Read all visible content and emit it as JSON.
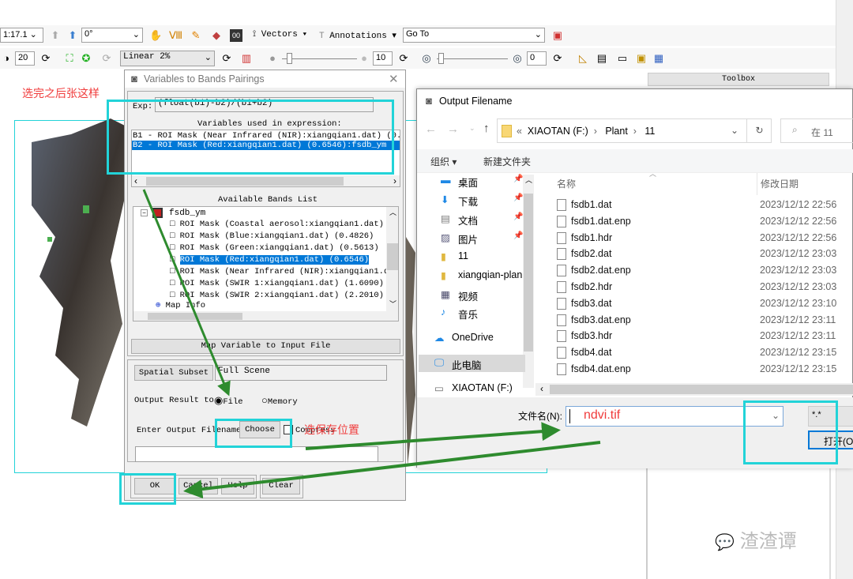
{
  "toolbar": {
    "scale_value": "1:17.1",
    "rotation_value": "0°",
    "vectors_label": "Vectors",
    "annotations_label": "Annotations",
    "goto_value": "Go To",
    "brightness_value": "20",
    "stretch_value": "Linear 2%",
    "sharpen_value": "10",
    "transparency_value": "0"
  },
  "toolbox": {
    "title": "Toolbox"
  },
  "annotation_text": {
    "after": "选完之后张这样",
    "choose_location": "选保存位置"
  },
  "variables_dialog": {
    "title": "Variables to Bands Pairings",
    "exp_label": "Exp:",
    "exp_value": "(float(b1)-b2)/(b1+b2)",
    "variables_heading": "Variables used in expression:",
    "variables": [
      "B1 - ROI Mask (Near Infrared (NIR):xiangqian1.dat) (0.864",
      "B2 - ROI Mask (Red:xiangqian1.dat) (0.6546):fsdb_ym"
    ],
    "bands_heading": "Available Bands List",
    "tree_root": "fsdb_ym",
    "bands": [
      "ROI Mask (Coastal aerosol:xiangqian1.dat) (",
      "ROI Mask (Blue:xiangqian1.dat) (0.4826)",
      "ROI Mask (Green:xiangqian1.dat) (0.5613)",
      "ROI Mask (Red:xiangqian1.dat) (0.6546)",
      "ROI Mask (Near Infrared (NIR):xiangqian1.da",
      "ROI Mask (SWIR 1:xiangqian1.dat) (1.6090)",
      "ROI Mask (SWIR 2:xiangqian1.dat) (2.2010)"
    ],
    "map_info": "Map Info",
    "map_variable_button": "Map Variable to Input File",
    "spatial_subset_button": "Spatial Subset",
    "spatial_subset_value": "Full Scene",
    "output_result_label": "Output Result to",
    "radio_file": "File",
    "radio_memory": "Memory",
    "output_filename_label": "Enter Output Filename",
    "choose_button": "Choose",
    "compress_label": "Compress",
    "output_filename_value": "",
    "ok_button": "OK",
    "cancel_button": "Cancel",
    "help_button": "Help",
    "clear_button": "Clear"
  },
  "file_dialog": {
    "title": "Output Filename",
    "breadcrumb": [
      "XIAOTAN (F:)",
      "Plant",
      "11"
    ],
    "breadcrumb_prefix": "«",
    "search_placeholder": "在 11",
    "organize_button": "组织",
    "new_folder_button": "新建文件夹",
    "nav_items": [
      {
        "label": "桌面",
        "icon": "desktop-icon",
        "pinned": true
      },
      {
        "label": "下载",
        "icon": "download-icon",
        "pinned": true
      },
      {
        "label": "文档",
        "icon": "document-icon",
        "pinned": true
      },
      {
        "label": "图片",
        "icon": "picture-icon",
        "pinned": true
      },
      {
        "label": "11",
        "icon": "folder-icon"
      },
      {
        "label": "xiangqian-plan",
        "icon": "folder-icon"
      },
      {
        "label": "视频",
        "icon": "video-icon"
      },
      {
        "label": "音乐",
        "icon": "music-icon"
      },
      {
        "label": "OneDrive",
        "icon": "cloud-icon"
      },
      {
        "label": "此电脑",
        "icon": "computer-icon",
        "selected": true
      },
      {
        "label": "XIAOTAN (F:)",
        "icon": "drive-icon"
      }
    ],
    "columns": {
      "name": "名称",
      "date": "修改日期"
    },
    "files": [
      {
        "name": "fsdb1.dat",
        "date": "2023/12/12 22:56"
      },
      {
        "name": "fsdb1.dat.enp",
        "date": "2023/12/12 22:56"
      },
      {
        "name": "fsdb1.hdr",
        "date": "2023/12/12 22:56"
      },
      {
        "name": "fsdb2.dat",
        "date": "2023/12/12 23:03"
      },
      {
        "name": "fsdb2.dat.enp",
        "date": "2023/12/12 23:03"
      },
      {
        "name": "fsdb2.hdr",
        "date": "2023/12/12 23:03"
      },
      {
        "name": "fsdb3.dat",
        "date": "2023/12/12 23:10"
      },
      {
        "name": "fsdb3.dat.enp",
        "date": "2023/12/12 23:11"
      },
      {
        "name": "fsdb3.hdr",
        "date": "2023/12/12 23:11"
      },
      {
        "name": "fsdb4.dat",
        "date": "2023/12/12 23:15"
      },
      {
        "name": "fsdb4.dat.enp",
        "date": "2023/12/12 23:15"
      }
    ],
    "filename_label": "文件名(N):",
    "filename_value": "ndvi.tif",
    "filter_value": "*.*",
    "open_button": "打开(O"
  },
  "watermark": "渣渣谭",
  "colors": {
    "highlight": "#22d3d8",
    "arrow": "#2e8b2e",
    "annotation": "#f03c3c",
    "selection": "#0078d7"
  }
}
